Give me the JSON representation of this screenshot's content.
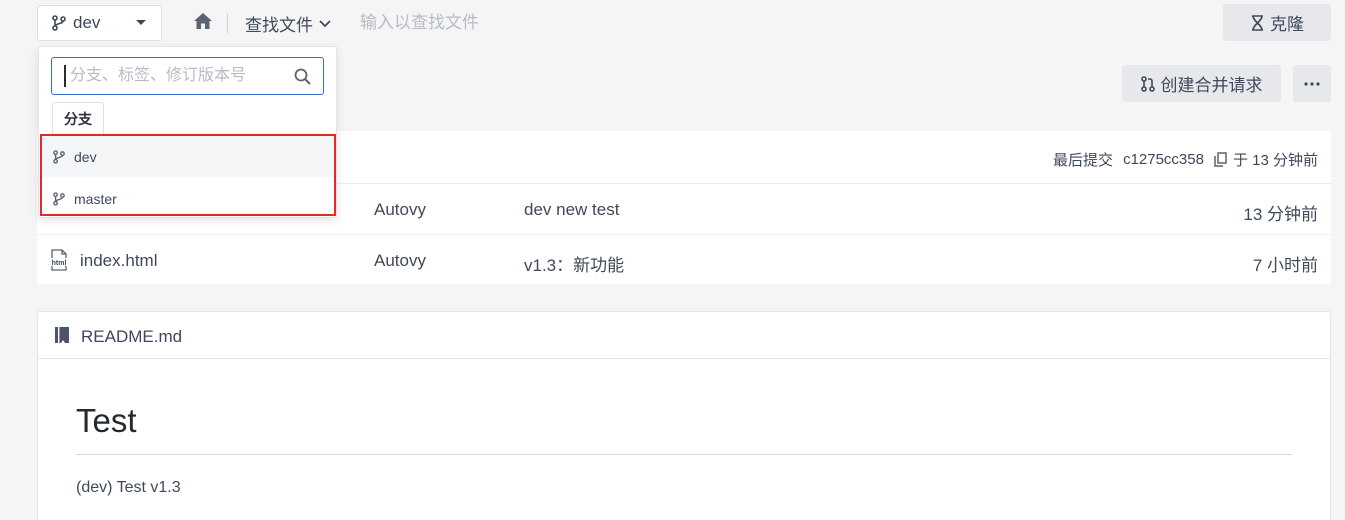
{
  "toolbar": {
    "branch": "dev",
    "find_file": "查找文件",
    "find_placeholder": "输入以查找文件",
    "clone": "克隆",
    "merge_request": "创建合并请求"
  },
  "branch_dropdown": {
    "search_placeholder": "分支、标签、修订版本号",
    "tab": "分支",
    "branches": [
      "dev",
      "master"
    ],
    "highlight_color": "#e32a2a"
  },
  "last_commit": {
    "label": "最后提交",
    "hash": "c1275cc358",
    "time": "于 13 分钟前"
  },
  "files": [
    {
      "name": "",
      "author": "Autovy",
      "message": "dev new test",
      "time": "13 分钟前"
    },
    {
      "name": "index.html",
      "author": "Autovy",
      "message": "v1.3：新功能",
      "time": "7 小时前",
      "icon": "html-file-icon"
    }
  ],
  "readme": {
    "filename": "README.md",
    "heading": "Test",
    "text": "(dev) Test v1.3"
  },
  "colors": {
    "accent_border": "#3a6ad7",
    "background": "#f5f5f6"
  }
}
